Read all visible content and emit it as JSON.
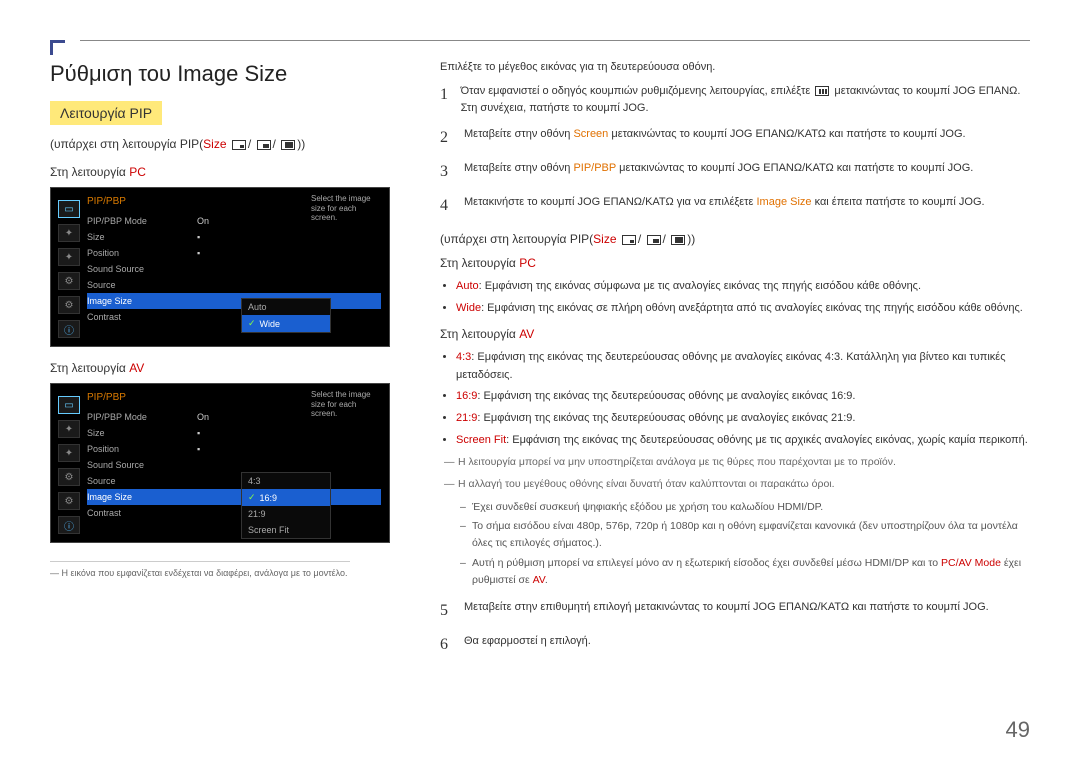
{
  "page": {
    "title": "Ρύθμιση του Image Size",
    "pip_label": "Λειτουργία PIP",
    "exists_in_pip": "(υπάρχει στη λειτουργία PIP(",
    "size_word": "Size",
    "close_paren": "))",
    "mode_pc": "Στη λειτουργία ",
    "pc": "PC",
    "av": "AV",
    "page_number": "49"
  },
  "osd": {
    "title": "PIP/PBP",
    "tip": "Select the image size for each screen.",
    "rows": {
      "mode": "PIP/PBP Mode",
      "mode_val": "On",
      "size": "Size",
      "position": "Position",
      "sound": "Sound Source",
      "source": "Source",
      "imgsize": "Image Size",
      "contrast": "Contrast"
    },
    "pc_opts": {
      "auto": "Auto",
      "wide": "Wide"
    },
    "av_opts": {
      "o43": "4:3",
      "o169": "16:9",
      "o219": "21:9",
      "fit": "Screen Fit"
    }
  },
  "footnote_left": "Η εικόνα που εμφανίζεται ενδέχεται να διαφέρει, ανάλογα με το μοντέλο.",
  "right": {
    "intro": "Επιλέξτε το μέγεθος εικόνας για τη δευτερεύουσα οθόνη.",
    "step1a": "Όταν εμφανιστεί ο οδηγός κουμπιών ρυθμιζόμενης λειτουργίας, επιλέξτε ",
    "step1b": " μετακινώντας το κουμπί JOG ΕΠΑΝΩ. Στη συνέχεια, πατήστε το κουμπί JOG.",
    "step2a": "Μεταβείτε στην οθόνη ",
    "screen": "Screen",
    "step2b": " μετακινώντας το κουμπί JOG ΕΠΑΝΩ/ΚΑΤΩ και πατήστε το κουμπί JOG.",
    "step3a": "Μεταβείτε στην οθόνη ",
    "pipbp": "PIP/PBP",
    "step3b": " μετακινώντας το κουμπί JOG ΕΠΑΝΩ/ΚΑΤΩ και πατήστε το κουμπί JOG.",
    "step4a": "Μετακινήστε το κουμπί JOG ΕΠΑΝΩ/ΚΑΤΩ για να επιλέξετε ",
    "imgsize": "Image Size",
    "step4b": " και έπειτα πατήστε το κουμπί JOG.",
    "pc_auto_l": "Auto",
    "pc_auto": ": Εμφάνιση της εικόνας σύμφωνα με τις αναλογίες εικόνας της πηγής εισόδου κάθε οθόνης.",
    "pc_wide_l": "Wide",
    "pc_wide": ": Εμφάνιση της εικόνας σε πλήρη οθόνη ανεξάρτητα από τις αναλογίες εικόνας της πηγής εισόδου κάθε οθόνης.",
    "av_43_l": "4:3",
    "av_43": ": Εμφάνιση της εικόνας της δευτερεύουσας οθόνης με αναλογίες εικόνας 4:3. Κατάλληλη για βίντεο και τυπικές μεταδόσεις.",
    "av_169_l": "16:9",
    "av_169": ": Εμφάνιση της εικόνας της δευτερεύουσας οθόνης με αναλογίες εικόνας 16:9.",
    "av_219_l": "21:9",
    "av_219": ": Εμφάνιση της εικόνας της δευτερεύουσας οθόνης με αναλογίες εικόνας 21:9.",
    "av_fit_l": "Screen Fit",
    "av_fit": ": Εμφάνιση της εικόνας της δευτερεύουσας οθόνης με τις αρχικές αναλογίες εικόνας, χωρίς καμία περικοπή.",
    "note1": "Η λειτουργία μπορεί να μην υποστηρίζεται ανάλογα με τις θύρες που παρέχονται με το προϊόν.",
    "note2": "Η αλλαγή του μεγέθους οθόνης είναι δυνατή όταν καλύπτονται οι παρακάτω όροι.",
    "sub1": "Έχει συνδεθεί συσκευή ψηφιακής εξόδου με χρήση του καλωδίου HDMI/DP.",
    "sub2": "Το σήμα εισόδου είναι 480p, 576p, 720p ή 1080p και η οθόνη εμφανίζεται κανονικά (δεν υποστηρίζουν όλα τα μοντέλα όλες τις επιλογές σήματος.).",
    "sub3a": "Αυτή η ρύθμιση μπορεί να επιλεγεί μόνο αν η εξωτερική είσοδος έχει συνδεθεί μέσω HDMI/DP και το ",
    "pcav": "PC/AV Mode",
    "sub3b": " έχει ρυθμιστεί σε ",
    "avword": "AV",
    "sub3c": ".",
    "step5": "Μεταβείτε στην επιθυμητή επιλογή μετακινώντας το κουμπί JOG ΕΠΑΝΩ/ΚΑΤΩ και πατήστε το κουμπί JOG.",
    "step6": "Θα εφαρμοστεί η επιλογή."
  }
}
